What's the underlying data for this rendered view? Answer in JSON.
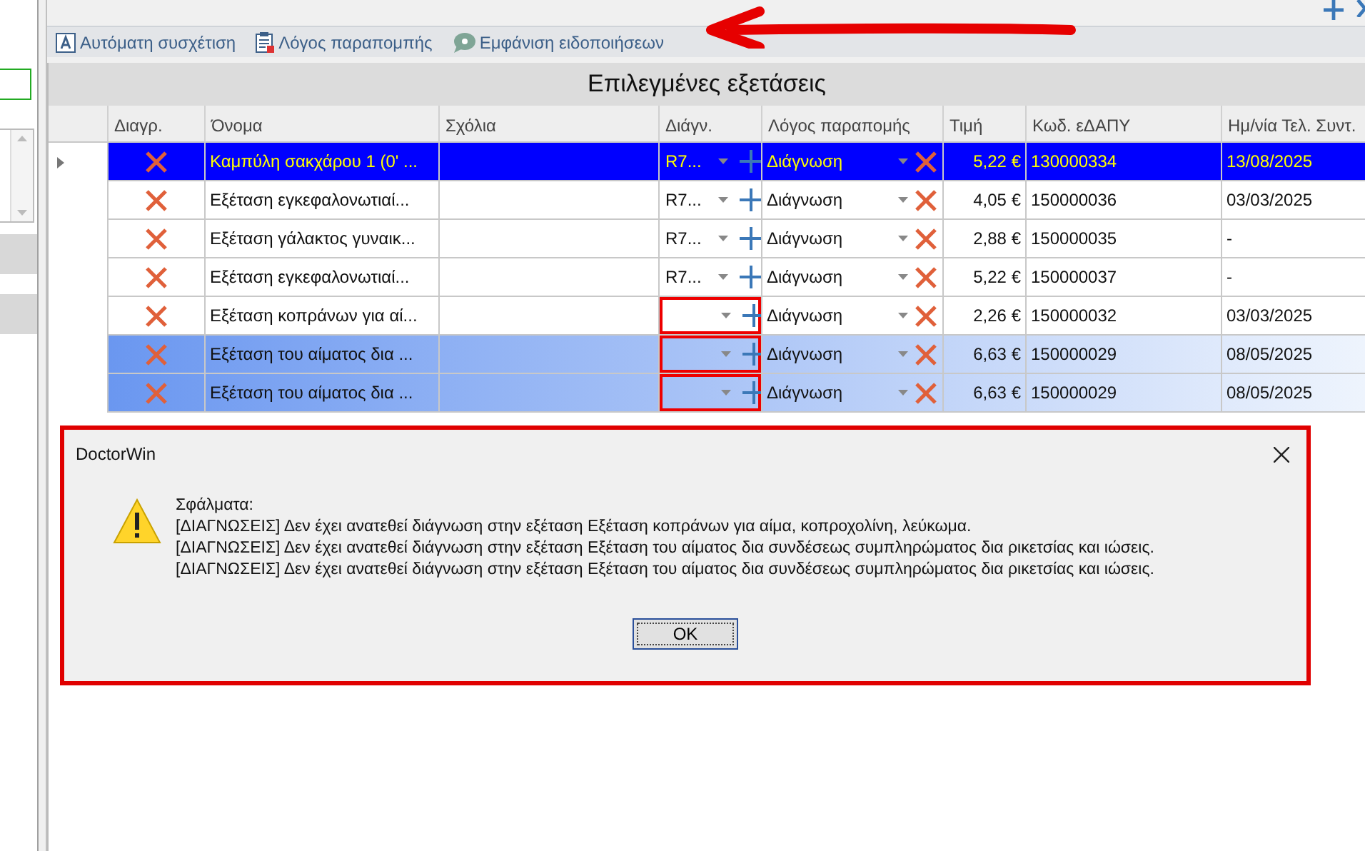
{
  "toolbar": [
    {
      "label": "Αυτόματη συσχέτιση",
      "kind": "auto"
    },
    {
      "label": "Λόγος παραπομπής",
      "kind": "clipboard"
    },
    {
      "label": "Εμφάνιση ειδοποιήσεων",
      "kind": "bubble"
    }
  ],
  "grid": {
    "title": "Επιλεγμένες εξετάσεις",
    "columns": [
      "Διαγρ.",
      "Όνομα",
      "Σχόλια",
      "Διάγν.",
      "Λόγος παραπομής",
      "Τιμή",
      "Κωδ. εΔΑΠΥ",
      "Ημ/νία Τελ. Συντ."
    ],
    "rows": [
      {
        "name": "Καμπύλη σακχάρου 1 (0' ...",
        "diagnosis": "R7...",
        "diagnosis_missing": false,
        "reason": "Διάγνωση",
        "price": "5,22 €",
        "code": "130000334",
        "date": "13/08/2025",
        "selected": true,
        "focused": true
      },
      {
        "name": "Εξέταση εγκεφαλονωτιαί...",
        "diagnosis": "R7...",
        "diagnosis_missing": false,
        "reason": "Διάγνωση",
        "price": "4,05 €",
        "code": "150000036",
        "date": "03/03/2025",
        "selected": false,
        "focused": false
      },
      {
        "name": "Εξέταση γάλακτος γυναικ...",
        "diagnosis": "R7...",
        "diagnosis_missing": false,
        "reason": "Διάγνωση",
        "price": "2,88 €",
        "code": "150000035",
        "date": "-",
        "selected": false,
        "focused": false
      },
      {
        "name": "Εξέταση εγκεφαλονωτιαί...",
        "diagnosis": "R7...",
        "diagnosis_missing": false,
        "reason": "Διάγνωση",
        "price": "5,22 €",
        "code": "150000037",
        "date": "-",
        "selected": false,
        "focused": false
      },
      {
        "name": "Εξέταση κοπράνων για αί...",
        "diagnosis_missing": true,
        "reason": "Διάγνωση",
        "price": "2,26 €",
        "code": "150000032",
        "date": "03/03/2025",
        "selected": false,
        "focused": false
      },
      {
        "name": "Εξέταση του αίματος δια ...",
        "diagnosis_missing": true,
        "reason": "Διάγνωση",
        "price": "6,63 €",
        "code": "150000029",
        "date": "08/05/2025",
        "selected": true,
        "focused": false
      },
      {
        "name": "Εξέταση του αίματος δια ...",
        "diagnosis_missing": true,
        "reason": "Διάγνωση",
        "price": "6,63 €",
        "code": "150000029",
        "date": "08/05/2025",
        "selected": true,
        "focused": false
      }
    ]
  },
  "dialog": {
    "title": "DoctorWin",
    "heading": "Σφάλματα:",
    "lines": [
      "[ΔΙΑΓΝΩΣΕΙΣ] Δεν έχει ανατεθεί διάγνωση στην εξέταση Εξέταση κοπράνων για αίμα, κοπροχολίνη, λεύκωμα.",
      "[ΔΙΑΓΝΩΣΕΙΣ] Δεν έχει ανατεθεί διάγνωση στην εξέταση Εξέταση του αίματος δια συνδέσεως συμπληρώματος δια ρικετσίας και ιώσεις.",
      "[ΔΙΑΓΝΩΣΕΙΣ] Δεν έχει ανατεθεί διάγνωση στην εξέταση Εξέταση του αίματος δια συνδέσεως συμπληρώματος δια ρικετσίας και ιώσεις."
    ],
    "button": "OK"
  }
}
